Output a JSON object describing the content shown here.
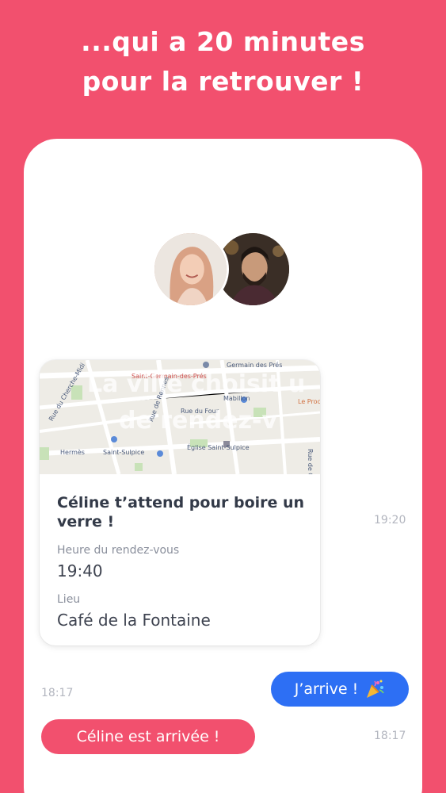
{
  "headline": {
    "line1": "...qui a 20 minutes",
    "line2": "pour la retrouver !"
  },
  "rdv_card": {
    "map_overlay_line1": "La ville choisit u",
    "map_overlay_line2": "de rendez-v",
    "map_labels": {
      "germain": "Germain des Prés",
      "saint_germain": "Saint-Germain-des-Prés",
      "mabillon": "Mabillon",
      "rue_du_four": "Rue du Four",
      "rue_de_rennes": "Rue de Rennes",
      "hermes": "Hermès",
      "saint_sulpice": "Saint-Sulpice",
      "eglise": "Église Saint-Sulpice",
      "le_proc": "Le Proc",
      "rue_du_cherche": "Rue du Cherche-Midi",
      "rue_de_grenelle": "Rue de Grenelle"
    },
    "title": "Céline t’attend pour boire un verre !",
    "time_label": "Heure du rendez-vous",
    "time_value": "19:40",
    "place_label": "Lieu",
    "place_value": "Café de la Fontaine"
  },
  "messages": {
    "card_time": "19:20",
    "sent_time": "18:17",
    "sent_text": "J’arrive !",
    "received_time": "18:17",
    "received_text": "Céline est arrivée !"
  },
  "colors": {
    "background": "#f2506e",
    "sent_bubble": "#2d6ff4",
    "received_bubble": "#f2506e"
  }
}
